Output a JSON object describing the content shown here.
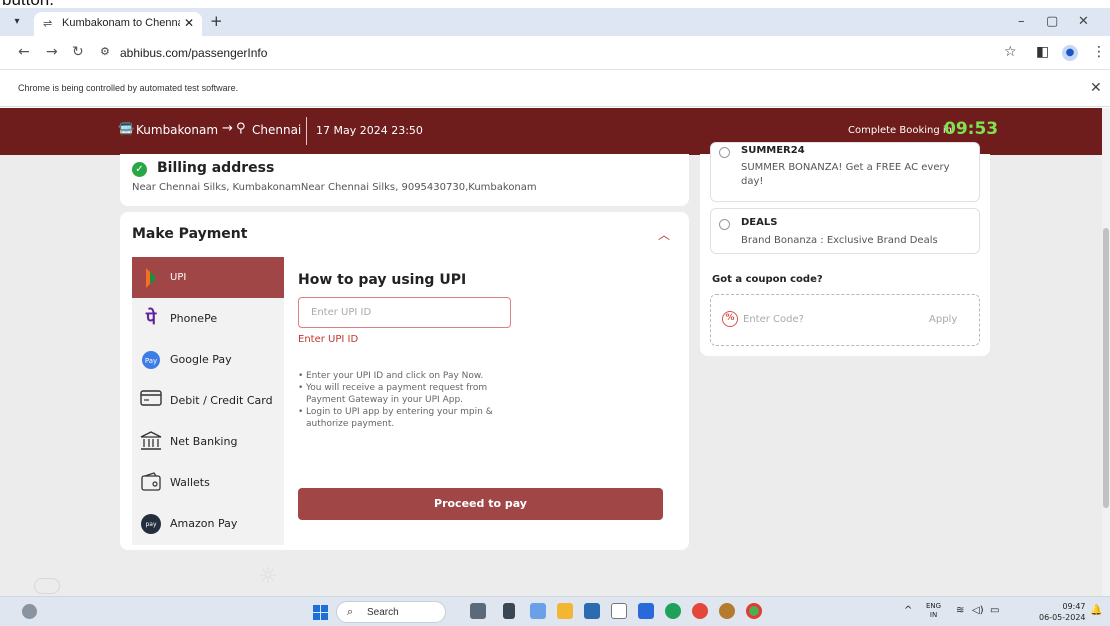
{
  "top_strip": {
    "text": "button."
  },
  "browser": {
    "tab_title": "Kumbakonam to Chennai Bus T",
    "url": "abhibus.com/passengerInfo",
    "automation_notice": "Chrome is being controlled by automated test software."
  },
  "header": {
    "from": "Kumbakonam",
    "to": "Chennai",
    "datetime": "17 May 2024 23:50",
    "complete_label": "Complete Booking in",
    "timer": "09:53",
    "timer_color": "#7ee34f"
  },
  "billing": {
    "title": "Billing address",
    "address": "Near Chennai Silks, KumbakonamNear Chennai Silks, 9095430730,Kumbakonam"
  },
  "payment": {
    "title": "Make Payment",
    "methods": [
      {
        "label": "UPI",
        "icon": "upi-icon"
      },
      {
        "label": "PhonePe",
        "icon": "phonepe-icon"
      },
      {
        "label": "Google Pay",
        "icon": "google-pay-icon"
      },
      {
        "label": "Debit / Credit Card",
        "icon": "card-icon"
      },
      {
        "label": "Net Banking",
        "icon": "bank-icon"
      },
      {
        "label": "Wallets",
        "icon": "wallet-icon"
      },
      {
        "label": "Amazon Pay",
        "icon": "amazon-pay-icon"
      }
    ],
    "upi_heading": "How to pay using UPI",
    "upi_placeholder": "Enter UPI ID",
    "upi_error": "Enter UPI ID",
    "instructions": [
      "Enter your UPI ID and click on Pay Now.",
      "You will receive a payment request from Payment Gateway in your UPI App.",
      "Login to UPI app by entering your mpin & authorize payment."
    ],
    "proceed_label": "Proceed to pay",
    "accent_color": "#a04646"
  },
  "coupons": {
    "items": [
      {
        "code": "SUMMER24",
        "desc": "SUMMER BONANZA! Get a FREE AC every day!"
      },
      {
        "code": "DEALS",
        "desc": "Brand Bonanza : Exclusive Brand Deals"
      }
    ],
    "got_label": "Got a coupon code?",
    "code_placeholder": "Enter Code?",
    "apply_label": "Apply"
  },
  "taskbar": {
    "search_label": "Search",
    "lang_top": "ENG",
    "lang_bottom": "IN",
    "time": "09:47",
    "date": "06-05-2024"
  }
}
